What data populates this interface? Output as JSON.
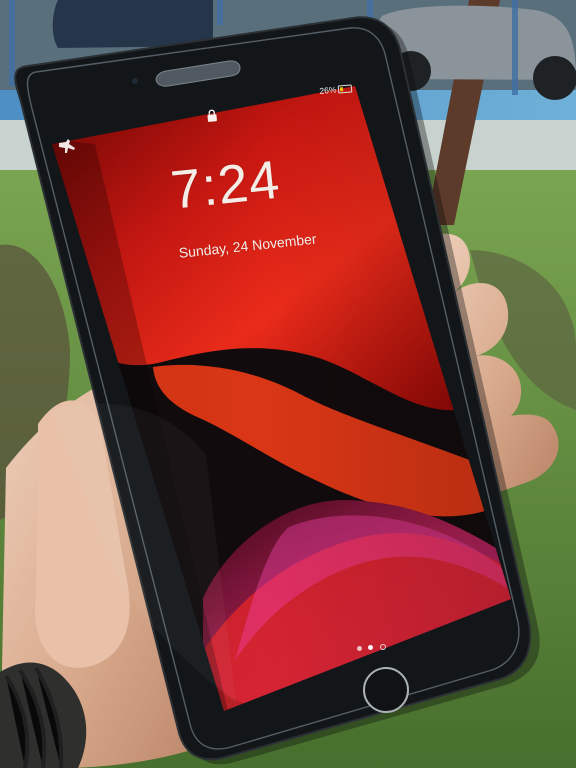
{
  "lockscreen": {
    "time": "7:24",
    "date": "Sunday, 24 November",
    "battery_percent": "26%"
  },
  "icons": {
    "status": [
      "airplane-icon",
      "lock-icon",
      "battery-icon"
    ],
    "controls": [
      "home-button",
      "page-dots"
    ]
  },
  "colors": {
    "wallpaper_red": "#d91f18",
    "wallpaper_magenta": "#b12a72",
    "phone_black": "#111316",
    "grass": "#5d8f3c"
  }
}
